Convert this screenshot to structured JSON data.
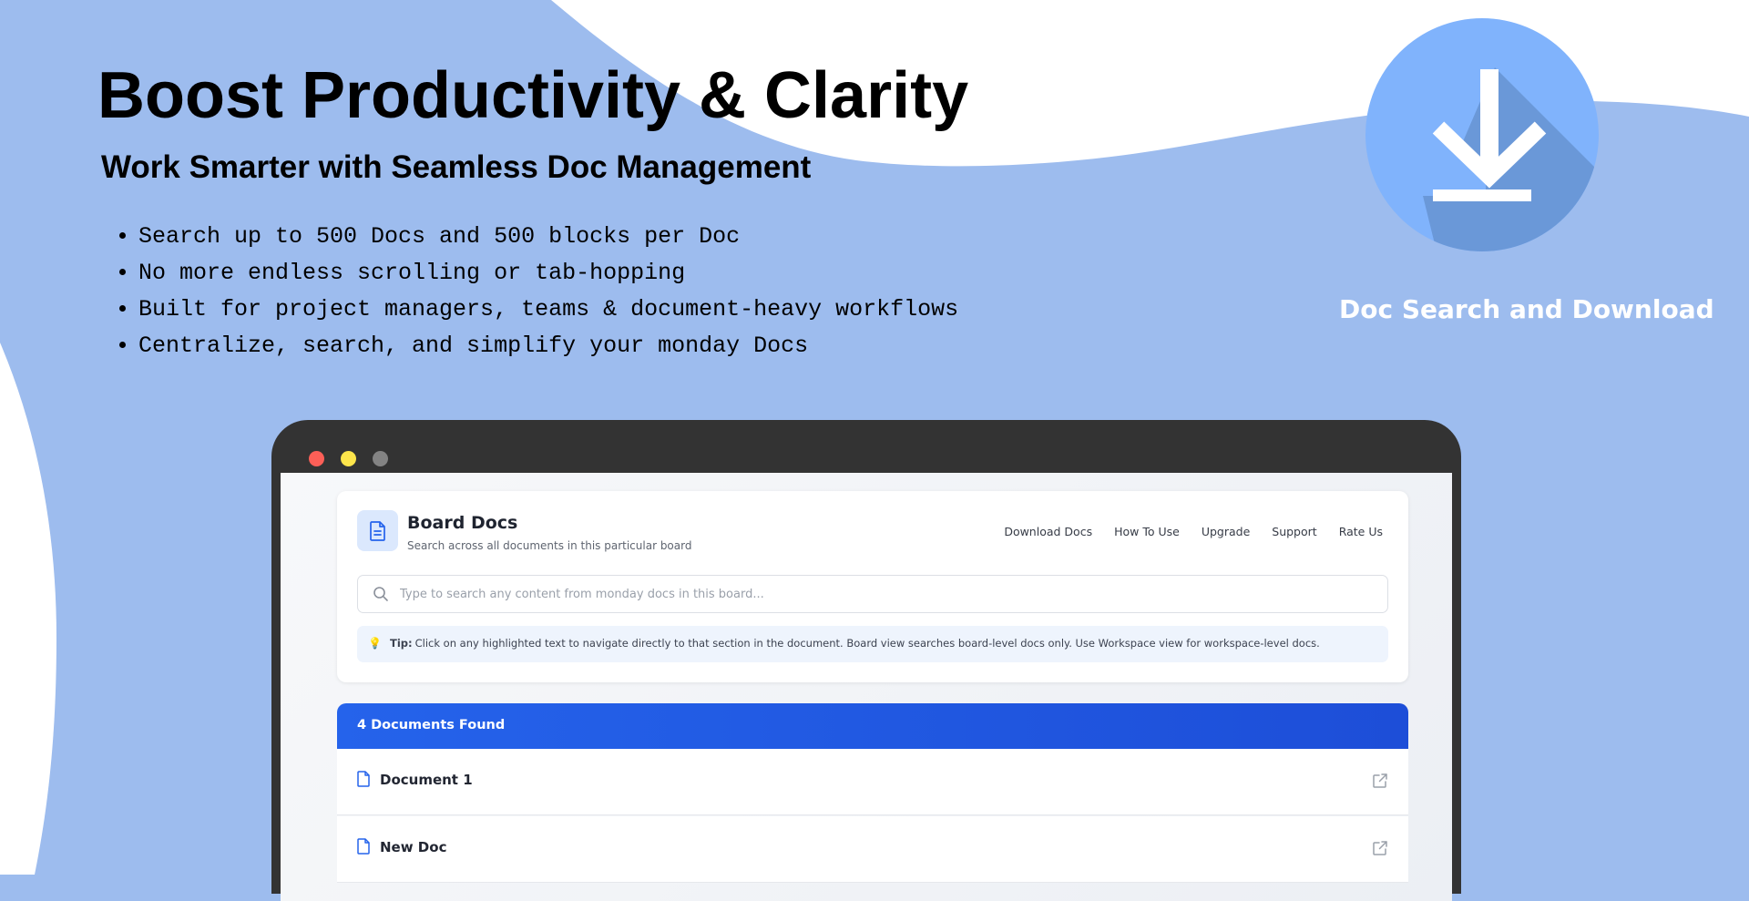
{
  "hero": {
    "title": "Boost Productivity & Clarity",
    "subtitle": "Work Smarter with Seamless Doc Management",
    "features": [
      "Search up to 500 Docs and 500 blocks per Doc",
      "No more endless scrolling or tab-hopping",
      "Built for project managers, teams & document-heavy workflows",
      "Centralize, search, and simplify your monday Docs"
    ]
  },
  "badge": {
    "icon": "download-arrow-icon",
    "caption": "Doc Search and Download"
  },
  "app": {
    "title": "Board Docs",
    "subtitle": "Search across all documents in this particular board",
    "nav": [
      "Download Docs",
      "How To Use",
      "Upgrade",
      "Support",
      "Rate Us"
    ],
    "search": {
      "placeholder": "Type to search any content from monday docs in this board...",
      "value": ""
    },
    "tip": {
      "label": "Tip:",
      "text": "Click on any highlighted text to navigate directly to that section in the document. Board view searches board-level docs only. Use Workspace view for workspace-level docs."
    },
    "results": {
      "count_label": "4 Documents Found",
      "documents": [
        "Document 1",
        "New Doc"
      ]
    }
  },
  "colors": {
    "background": "#9dbcee",
    "badge": "#80b3fc",
    "accent": "#2563eb",
    "device": "#333333"
  }
}
